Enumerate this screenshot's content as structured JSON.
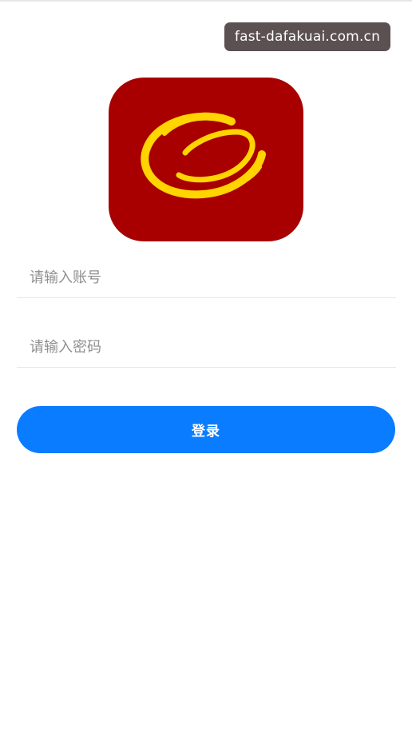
{
  "watermark": {
    "text": "fast-dafakuai.com.cn"
  },
  "logo": {
    "icon": "app-logo",
    "background_color": "#a80000",
    "ring_color": "#ffd400"
  },
  "login_form": {
    "account_placeholder": "请输入账号",
    "account_value": "",
    "password_placeholder": "请输入密码",
    "password_value": "",
    "submit_label": "登录"
  },
  "colors": {
    "primary": "#0a7cff",
    "divider": "#e3e7ee",
    "placeholder": "#8f8f8f"
  }
}
